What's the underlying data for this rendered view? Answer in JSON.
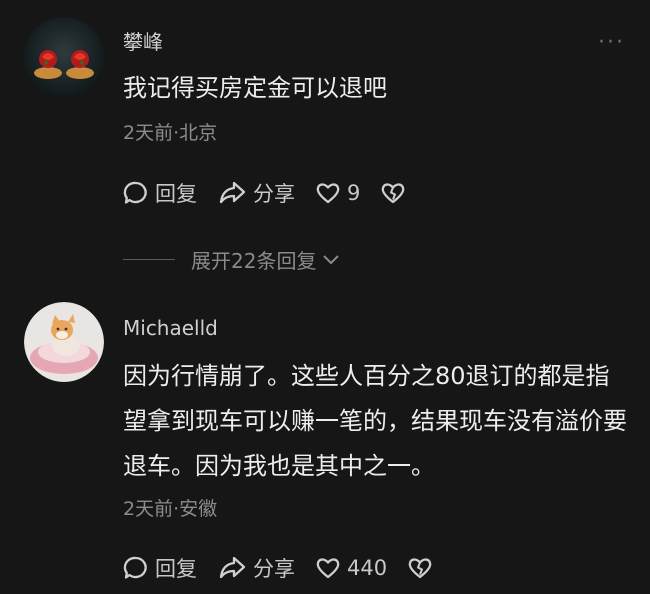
{
  "comments": [
    {
      "author": "攀峰",
      "text": "我记得买房定金可以退吧",
      "meta": "2天前·北京",
      "reply_label": "回复",
      "share_label": "分享",
      "likes": "9"
    },
    {
      "author": "Michaelld",
      "text": "因为行情崩了。这些人百分之80退订的都是指望拿到现车可以赚一笔的，结果现车没有溢价要退车。因为我也是其中之一。",
      "meta": "2天前·安徽",
      "reply_label": "回复",
      "share_label": "分享",
      "likes": "440"
    }
  ],
  "expand_label": "展开22条回复",
  "icons": [
    "comment-icon",
    "share-icon",
    "heart-icon",
    "broken-heart-icon",
    "chevron-down-icon",
    "more-icon"
  ]
}
